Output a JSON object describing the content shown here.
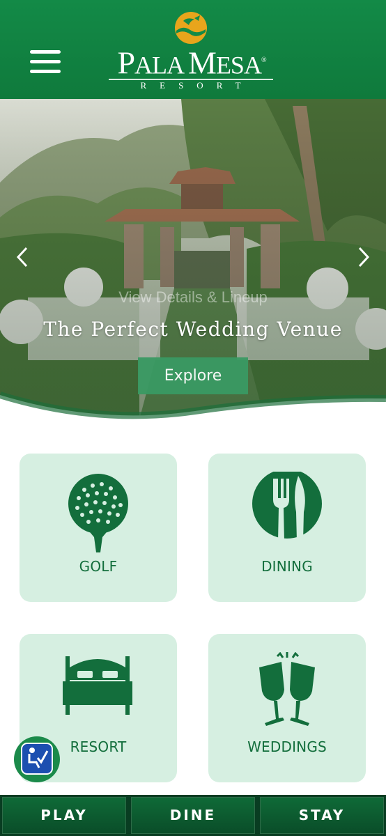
{
  "header": {
    "brand_name_first": "P",
    "brand_name_rest1": "ALA ",
    "brand_name_m": "M",
    "brand_name_rest2": "ESA",
    "brand_sub": "RESORT",
    "brand_mark": "®",
    "menu_icon": "hamburger-menu-icon"
  },
  "hero": {
    "ghost_text": "View Details & Lineup",
    "title": "The Perfect Wedding Venue",
    "explore_label": "Explore",
    "prev_icon": "chevron-left-icon",
    "next_icon": "chevron-right-icon"
  },
  "tiles": [
    {
      "label": "GOLF",
      "icon": "golf-ball-icon"
    },
    {
      "label": "DINING",
      "icon": "fork-knife-icon"
    },
    {
      "label": "RESORT",
      "icon": "bed-icon"
    },
    {
      "label": "WEDDINGS",
      "icon": "champagne-glasses-icon"
    }
  ],
  "accessibility": {
    "icon": "accessibility-icon"
  },
  "bottom_nav": {
    "play": "PLAY",
    "dine": "DINE",
    "stay": "STAY"
  },
  "colors": {
    "brand_green": "#138a47",
    "tile_bg": "#d6efe1",
    "tile_text": "#136e3c",
    "nav_dark": "#093d22",
    "gold": "#e8a51c"
  }
}
